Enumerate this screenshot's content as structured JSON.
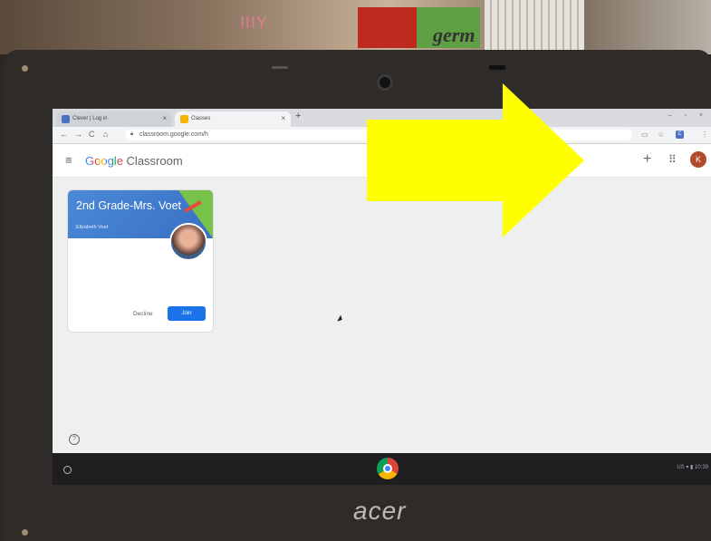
{
  "background": {
    "wall_text": "germ",
    "wall_pink_text": "IIIY"
  },
  "browser": {
    "tabs": [
      {
        "label": "Clever | Log in",
        "icon": "clever-icon"
      },
      {
        "label": "Classes",
        "icon": "classroom-icon"
      }
    ],
    "close_glyph": "×",
    "new_tab_glyph": "+",
    "window_controls": "– ▫ ×",
    "url": "classroom.google.com/h",
    "profile_badge": "C"
  },
  "app": {
    "brand_google": "Google",
    "brand_product": "Classroom",
    "avatar_letter": "K",
    "menu_glyph": "≡",
    "add_glyph": "+",
    "apps_glyph": "⠿"
  },
  "class_card": {
    "title": "2nd Grade-Mrs. Voet",
    "teacher": "Elizabeth Voet",
    "decline_label": "Decline",
    "join_label": "Join"
  },
  "help_glyph": "?",
  "shelf": {
    "tray": "US ▾ ▮ 10:39"
  },
  "laptop_brand": "acer",
  "colors": {
    "arrow": "#ffff00",
    "join": "#1a73e8",
    "banner": "#4a8ad8"
  }
}
